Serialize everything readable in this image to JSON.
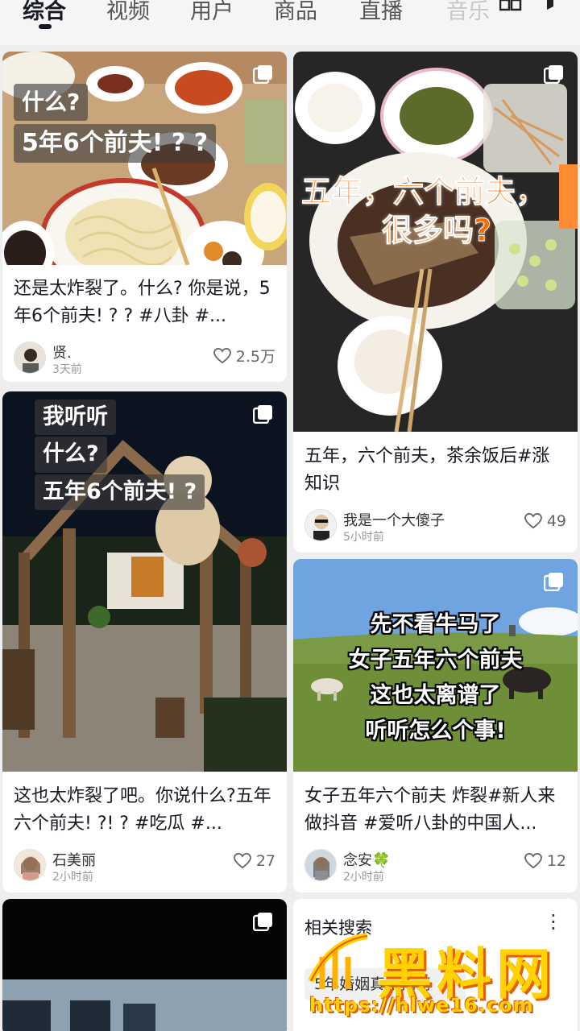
{
  "tabs": [
    {
      "label": "综合",
      "active": true
    },
    {
      "label": "视频",
      "active": false
    },
    {
      "label": "用户",
      "active": false
    },
    {
      "label": "商品",
      "active": false
    },
    {
      "label": "直播",
      "active": false
    },
    {
      "label": "音乐",
      "active": false
    }
  ],
  "cards": [
    {
      "overlay": [
        "什么?",
        "5年6个前夫! ? ?"
      ],
      "description": "还是太炸裂了。什么? 你是说，5年6个前夫! ? ?  #八卦 #...",
      "author": "贤.",
      "time": "3天前",
      "likes": "2.5万"
    },
    {
      "overlay": [
        "五年，六个前夫，",
        "很多吗?"
      ],
      "description": "五年，六个前夫，茶余饭后#涨知识",
      "author": "我是一个大傻子",
      "time": "5小时前",
      "likes": "49"
    },
    {
      "overlay": [
        "我听听",
        "什么?",
        "五年6个前夫! ?"
      ],
      "description": "这也太炸裂了吧。你说什么?五年六个前夫! ?! ? #吃瓜 #...",
      "author": "石美丽",
      "time": "2小时前",
      "likes": "27"
    },
    {
      "overlay": [
        "先不看牛马了",
        "女子五年六个前夫",
        "这也太离谱了",
        "听听怎么个事!"
      ],
      "description": "女子五年六个前夫 炸裂#新人来做抖音 #爱听八卦的中国人...",
      "author": "念安🍀",
      "time": "2小时前",
      "likes": "12"
    }
  ],
  "related": {
    "title": "相关搜索",
    "item": "5年婚姻真相揭秘"
  },
  "watermark": {
    "logo": "黑料网",
    "url": "https://hlwe16.com"
  },
  "colors": {
    "accent_orange": "#ff6a00",
    "watermark_yellow": "#ffd200"
  }
}
